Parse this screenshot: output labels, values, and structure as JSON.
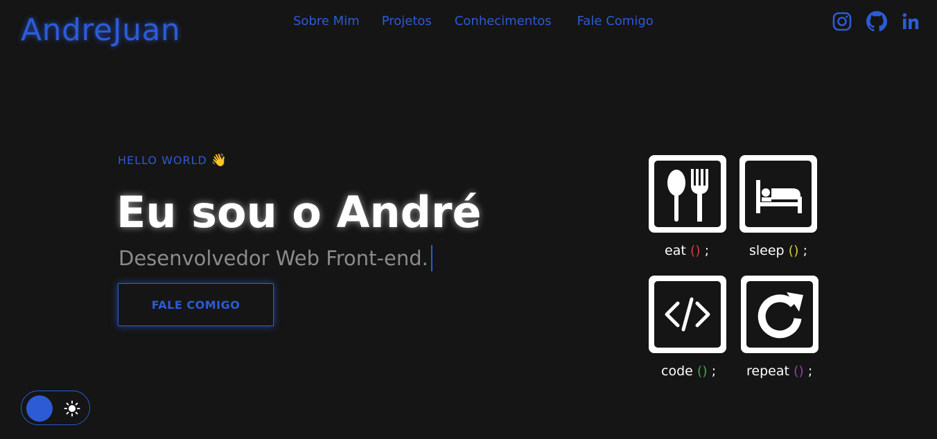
{
  "header": {
    "logo": "AndreJuan",
    "nav": [
      "Sobre Mim",
      "Projetos",
      "Conhecimentos",
      "Fale Comigo"
    ],
    "socials": [
      "instagram-icon",
      "github-icon",
      "linkedin-icon"
    ]
  },
  "hero": {
    "eyebrow": "HELLO WORLD",
    "eyebrow_emoji": "👋",
    "title": "Eu sou o André",
    "subtitle": "Desenvolvedor Web Front-end.",
    "cta": "FALE COMIGO"
  },
  "routine": [
    {
      "icon": "fork-spoon-icon",
      "word": "eat",
      "paren_color": "#d23c3c"
    },
    {
      "icon": "bed-icon",
      "word": "sleep",
      "paren_color": "#d8c83a"
    },
    {
      "icon": "code-icon",
      "word": "code",
      "paren_color": "#3aa84a"
    },
    {
      "icon": "repeat-icon",
      "word": "repeat",
      "paren_color": "#9b3ab0"
    }
  ],
  "routine_suffix": ";",
  "routine_open": "(",
  "routine_close": ")",
  "theme_toggle": {
    "icon": "sun-icon",
    "mode": "dark"
  },
  "colors": {
    "accent": "#2d5bd6",
    "background": "#151515",
    "text": "#ffffff",
    "muted": "#8b8b8b"
  }
}
